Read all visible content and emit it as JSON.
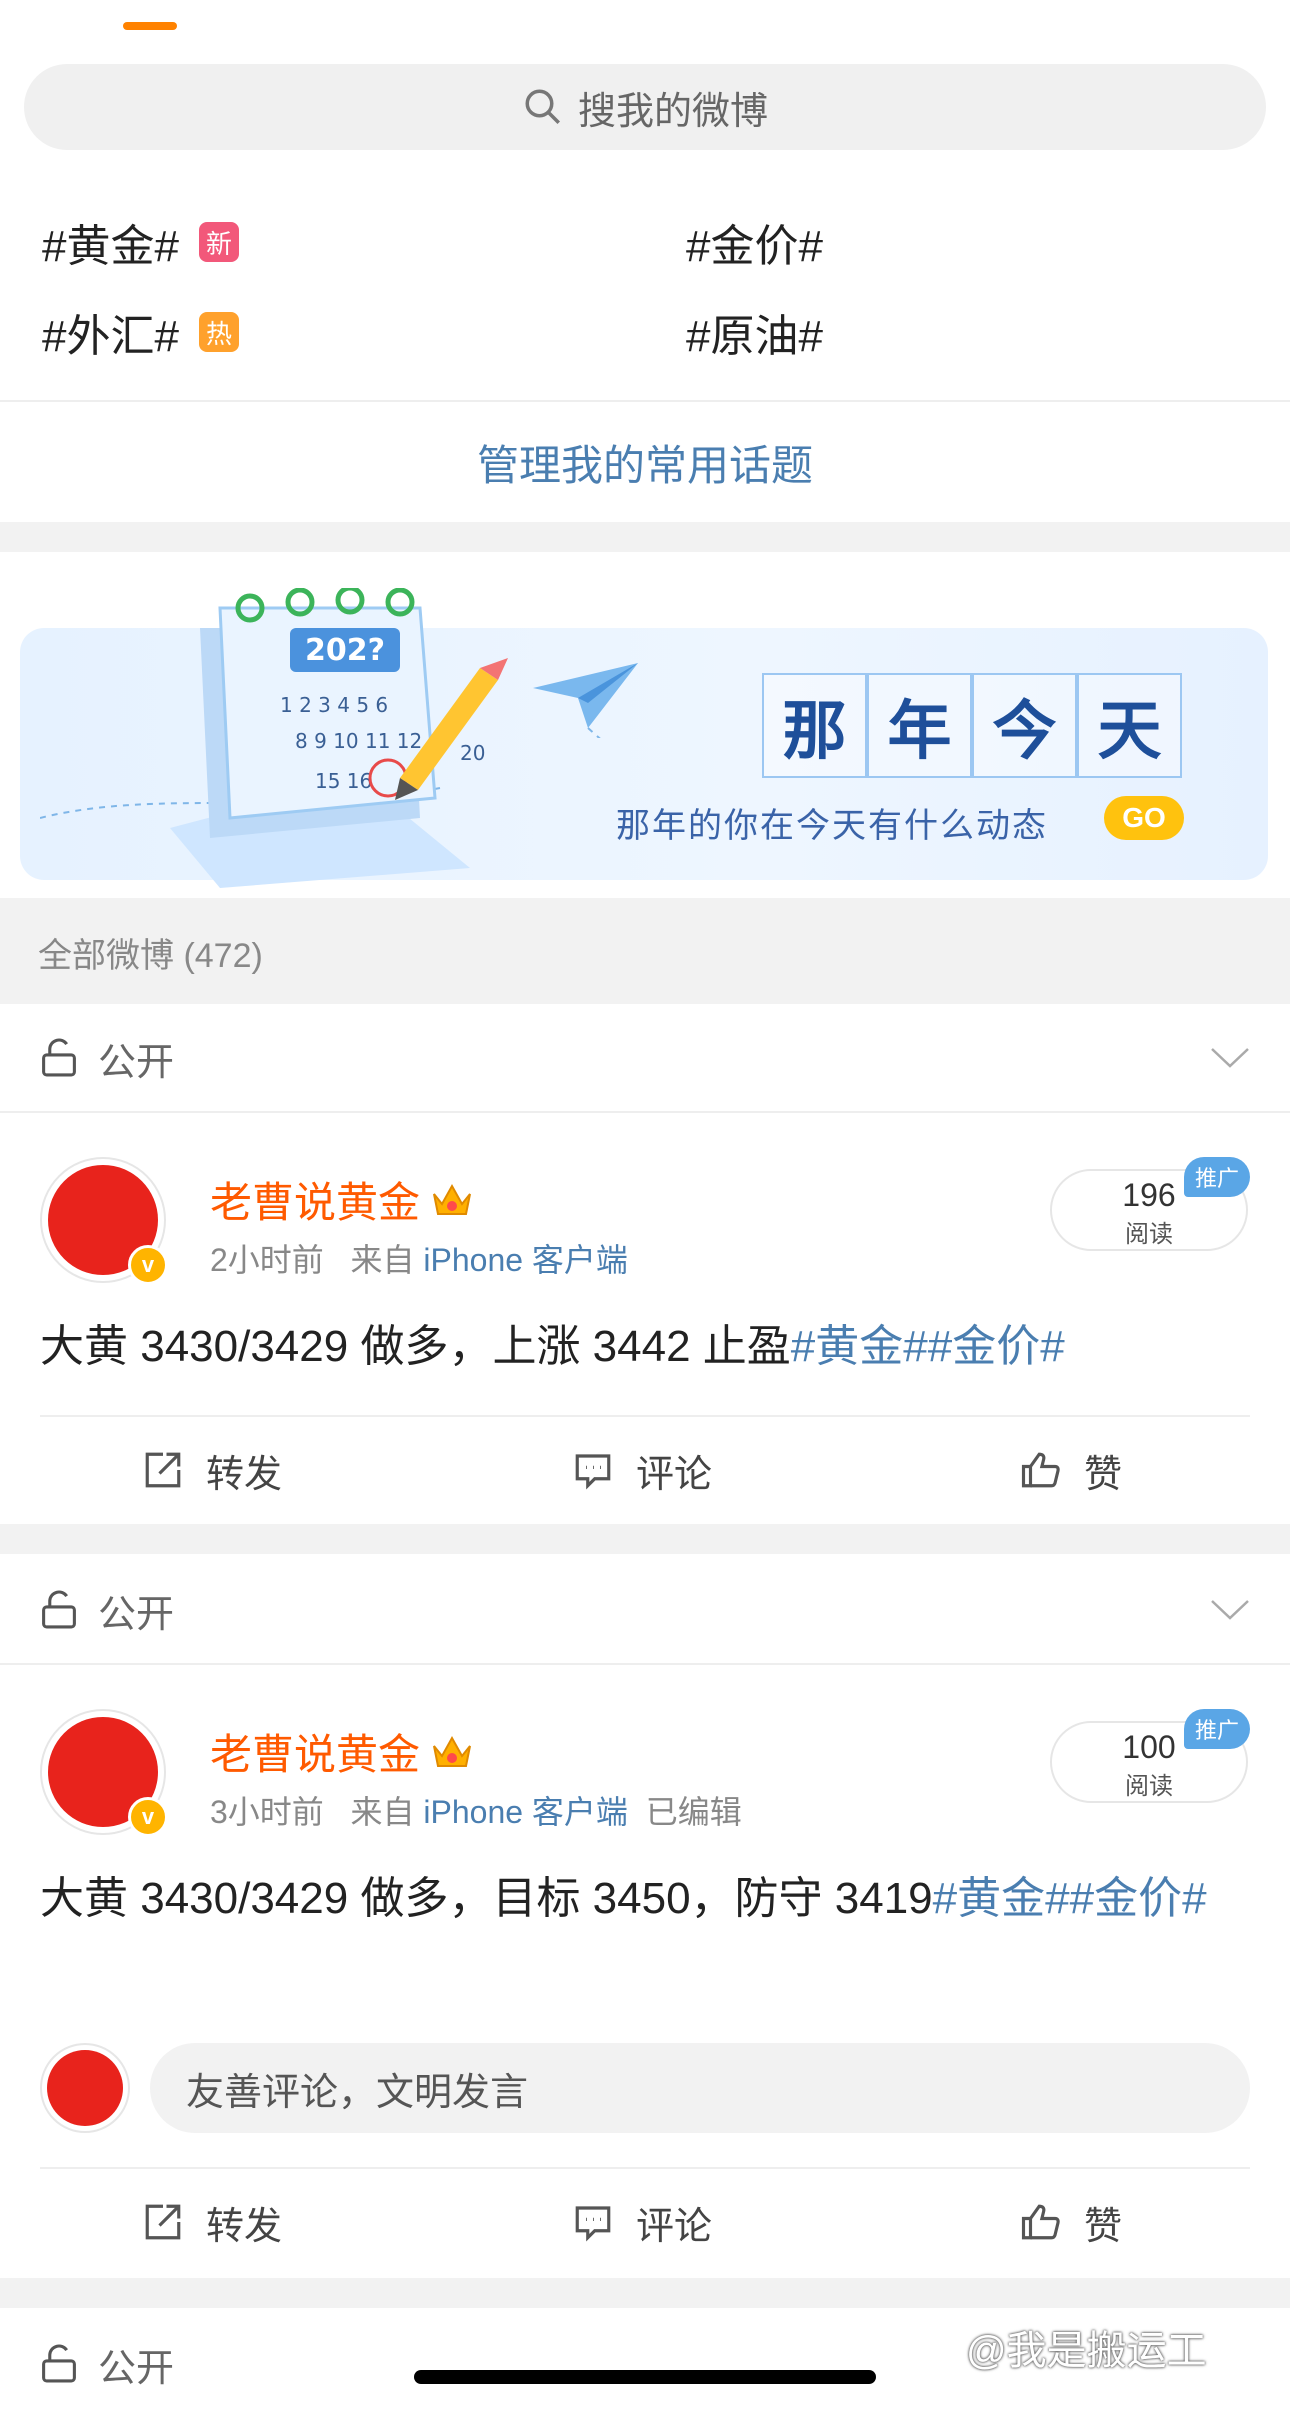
{
  "search": {
    "placeholder": "搜我的微博"
  },
  "topics": [
    {
      "label": "#黄金#",
      "badge": "新"
    },
    {
      "label": "#金价#",
      "badge": ""
    },
    {
      "label": "#外汇#",
      "badge": "热"
    },
    {
      "label": "#原油#",
      "badge": ""
    }
  ],
  "manage_topics_label": "管理我的常用话题",
  "banner": {
    "title_chars": [
      "那",
      "年",
      "今",
      "天"
    ],
    "subtitle": "那年的你在今天有什么动态",
    "go_label": "GO",
    "calendar_year": "202?"
  },
  "all_posts_label": "全部微博 (472)",
  "privacy_label": "公开",
  "posts": [
    {
      "username": "老曹说黄金",
      "time": "2小时前",
      "from_label": "来自",
      "source": "iPhone 客户端",
      "edited": "",
      "read_count": "196",
      "read_label": "阅读",
      "promo_label": "推广",
      "text": "大黄 3430/3429 做多，上涨 3442 止盈",
      "tags": "#黄金##金价#"
    },
    {
      "username": "老曹说黄金",
      "time": "3小时前",
      "from_label": "来自",
      "source": "iPhone 客户端",
      "edited": "已编辑",
      "read_count": "100",
      "read_label": "阅读",
      "promo_label": "推广",
      "text": "大黄 3430/3429 做多，目标 3450，防守 3419",
      "tags": "#黄金##金价#",
      "comment_placeholder": "友善评论，文明发言"
    }
  ],
  "actions": {
    "repost": "转发",
    "comment": "评论",
    "like": "赞"
  },
  "verified_badge": "v",
  "watermark": "@我是搬运工",
  "colors": {
    "accent": "#ff8200",
    "link": "#4a7eb0",
    "username": "#ff5a00"
  }
}
